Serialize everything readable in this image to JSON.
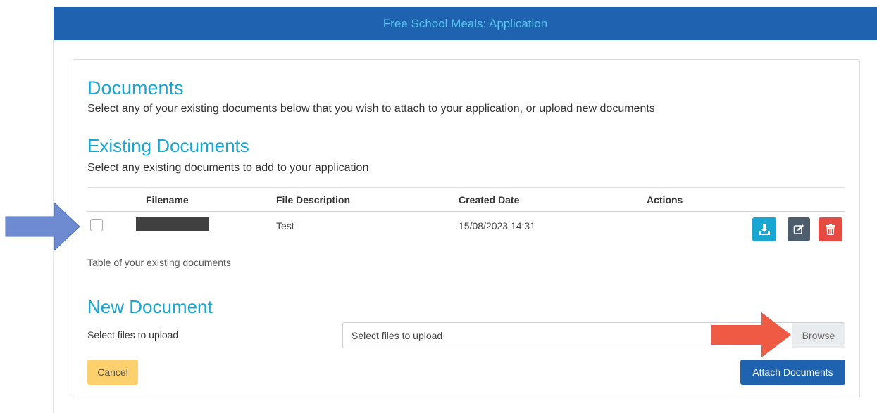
{
  "banner": {
    "title": "Free School Meals: Application"
  },
  "documents": {
    "heading": "Documents",
    "description": "Select any of your existing documents below that you wish to attach to your application, or upload new documents"
  },
  "existing": {
    "heading": "Existing Documents",
    "description": "Select any existing documents to add to your application",
    "columns": [
      "Filename",
      "File Description",
      "Created Date",
      "Actions"
    ],
    "rows": [
      {
        "filename": "",
        "description": "Test",
        "created": "15/08/2023 14:31"
      }
    ],
    "caption": "Table of your existing documents"
  },
  "new_document": {
    "heading": "New Document",
    "label": "Select files to upload",
    "placeholder": "Select files to upload",
    "browse_label": "Browse"
  },
  "footer": {
    "cancel_label": "Cancel",
    "attach_label": "Attach Documents"
  },
  "icons": {
    "download": "download-icon",
    "edit": "edit-icon",
    "delete": "trash-icon"
  },
  "colors": {
    "banner": "#1f63b0",
    "heading": "#17a7d2",
    "download": "#17a7d2",
    "edit": "#4d5d6c",
    "delete": "#e64b43",
    "cancel": "#fcd16d",
    "attach": "#1f63b0",
    "annotation_blue": "#6e8ad0",
    "annotation_red": "#ef5a44"
  }
}
